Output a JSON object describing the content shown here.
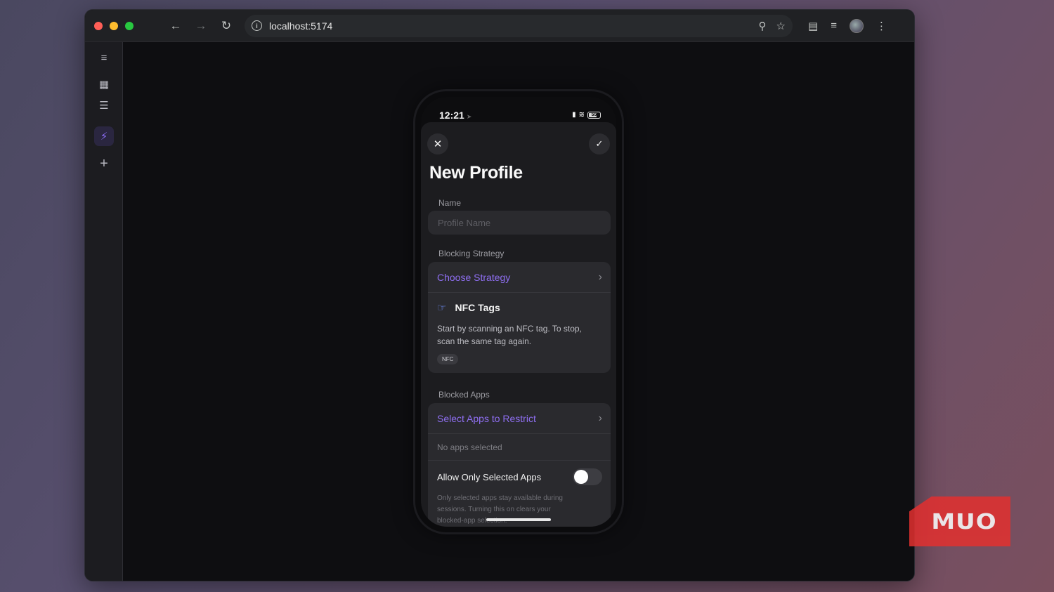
{
  "browser": {
    "url": "localhost:5174",
    "icons": {
      "back": "arrow-left-icon",
      "forward": "arrow-right-icon",
      "reload": "reload-icon",
      "info": "info-icon",
      "zoom": "zoom-icon",
      "bookmark": "star-icon",
      "extensions": "puzzle-icon",
      "media": "media-queue-icon",
      "menu": "kebab-menu-icon"
    }
  },
  "sidebar": {
    "items": [
      {
        "name": "sidebar-toggle-icon"
      },
      {
        "name": "apps-grid-icon"
      },
      {
        "name": "search-list-icon"
      },
      {
        "name": "app-logo-icon",
        "active": true
      },
      {
        "name": "add-icon"
      }
    ]
  },
  "phone": {
    "status": {
      "time": "12:21",
      "battery": "55"
    },
    "header": {
      "title": "New Profile"
    },
    "name_section": {
      "label": "Name",
      "placeholder": "Profile Name"
    },
    "strategy_section": {
      "label": "Blocking Strategy",
      "choose_label": "Choose Strategy",
      "selected": {
        "title": "NFC Tags",
        "description": "Start by scanning an NFC tag. To stop, scan the same tag again.",
        "chip": "NFC"
      }
    },
    "apps_section": {
      "label": "Blocked Apps",
      "select_label": "Select Apps to Restrict",
      "empty_text": "No apps selected",
      "toggle_label": "Allow Only Selected Apps",
      "toggle_on": false,
      "toggle_description": "Only selected apps stay available during sessions. Turning this on clears your blocked-app selection."
    }
  },
  "watermark": {
    "text": "MUO",
    "color": "#e3302f"
  },
  "colors": {
    "accent": "#8f6ff2",
    "nfc_icon": "#6d8cf5"
  }
}
